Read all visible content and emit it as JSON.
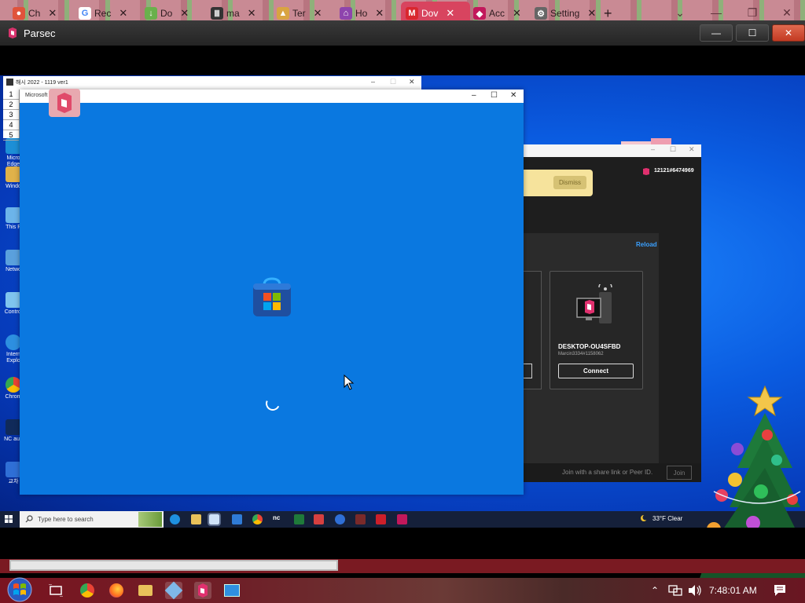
{
  "browser": {
    "tabs": [
      {
        "label": "Ch",
        "icon": "chrome-icon"
      },
      {
        "label": "Rec",
        "icon": "google-icon"
      },
      {
        "label": "Do",
        "icon": "download-icon"
      },
      {
        "label": "ma",
        "icon": "museum-icon"
      },
      {
        "label": "Ter",
        "icon": "terms-icon"
      },
      {
        "label": "Ho",
        "icon": "home-icon"
      },
      {
        "label": "Dov",
        "icon": "mega-icon",
        "active": true
      },
      {
        "label": "Acc",
        "icon": "parsec-icon"
      },
      {
        "label": "Setting",
        "icon": "gear-icon"
      }
    ],
    "new_tab": "+",
    "controls": {
      "list": "⌄",
      "minimize": "—",
      "restore": "❐",
      "close": "✕"
    }
  },
  "parsec_window": {
    "title": "Parsec",
    "controls": {
      "minimize": "—",
      "maximize": "☐",
      "close": "✕"
    }
  },
  "remote": {
    "old_window": {
      "title": "해시 2022 - 1119 ver1",
      "row_numbers": [
        "1",
        "2",
        "3",
        "4",
        "5"
      ],
      "controls": {
        "minimize": "–",
        "maximize": "☐",
        "close": "✕"
      }
    },
    "desktop_icons": [
      {
        "label": "Micro Edge"
      },
      {
        "label": "Windo"
      },
      {
        "label": "This P"
      },
      {
        "label": "Netwo"
      },
      {
        "label": "Control"
      },
      {
        "label": "Intern Explo"
      },
      {
        "label": "Chrom"
      },
      {
        "label": "NC aun"
      },
      {
        "label": "교차"
      }
    ],
    "store_window": {
      "title": "Microsoft Store",
      "controls": {
        "minimize": "–",
        "maximize": "☐",
        "close": "✕"
      }
    },
    "parsec_app": {
      "banner_button": "Dismiss",
      "peer_id": "12121#6474969",
      "reload": "Reload",
      "device": {
        "name": "DESKTOP-OU4SFBD",
        "user": "Marcin3334#1158062",
        "connect": "Connect"
      },
      "footer": {
        "join_text": "Join with a share link or Peer ID.",
        "join_button": "Join"
      }
    },
    "taskbar": {
      "search_placeholder": "Type here to search",
      "weather": "33°F Clear"
    }
  },
  "host_taskbar": {
    "clock": "7:48:01 AM",
    "tray_expand": "⌃"
  }
}
